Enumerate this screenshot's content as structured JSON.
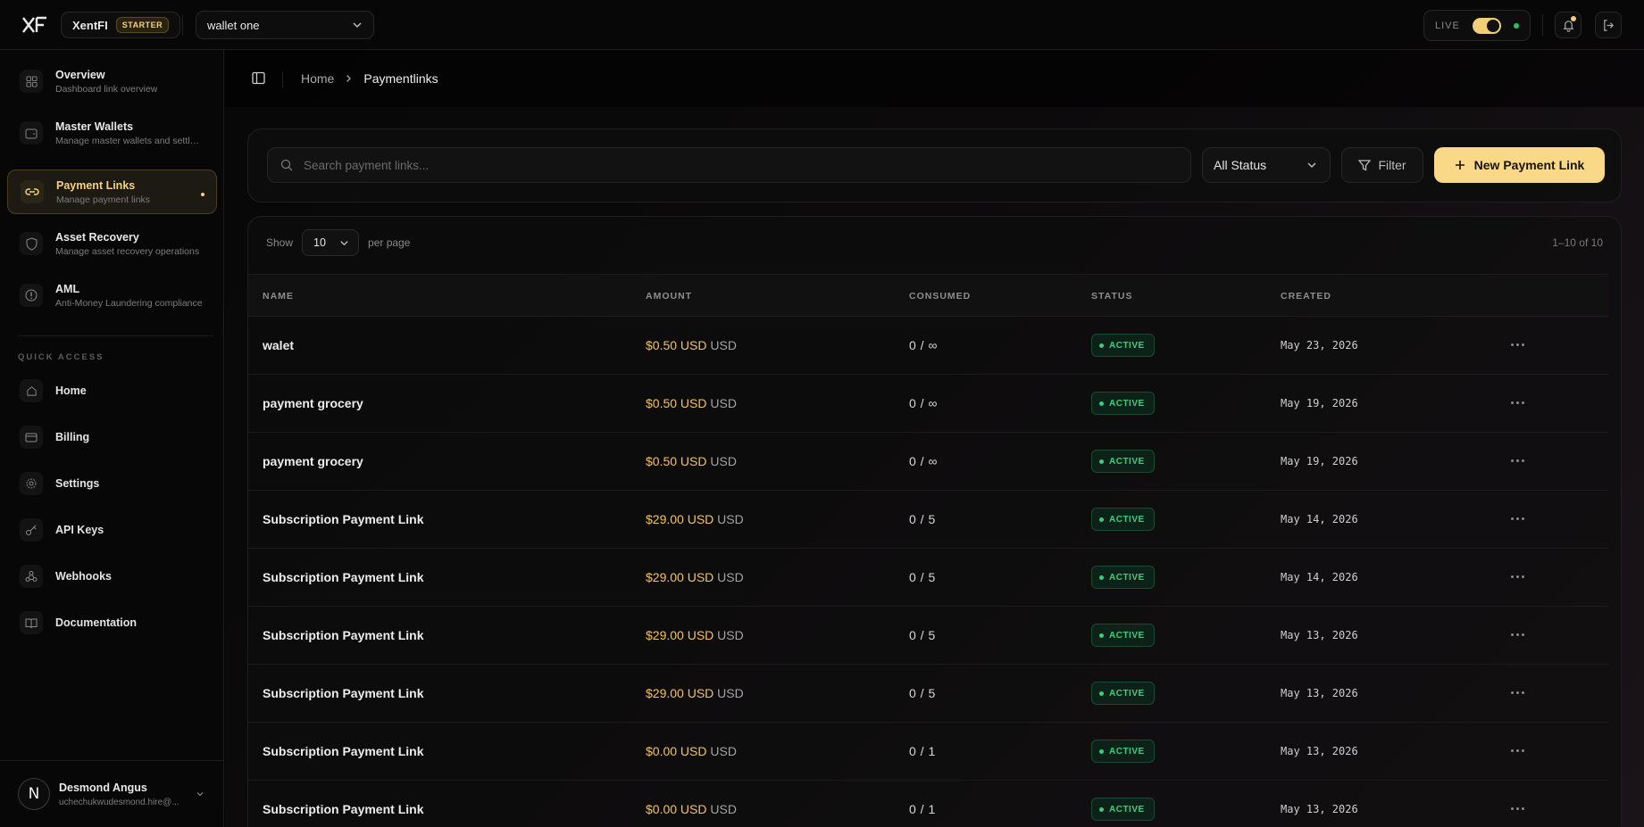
{
  "topbar": {
    "org_name": "XentFI",
    "plan_badge": "STARTER",
    "wallet": "wallet one",
    "live_label": "LIVE"
  },
  "sidebar": {
    "nav": [
      {
        "title": "Overview",
        "subtitle": "Dashboard link overview",
        "icon": "grid-icon",
        "active": false
      },
      {
        "title": "Master Wallets",
        "subtitle": "Manage master wallets and settle...",
        "icon": "wallet-icon",
        "active": false
      },
      {
        "title": "Payment Links",
        "subtitle": "Manage payment links",
        "icon": "link-icon",
        "active": true
      },
      {
        "title": "Asset Recovery",
        "subtitle": "Manage asset recovery operations",
        "icon": "shield-icon",
        "active": false
      },
      {
        "title": "AML",
        "subtitle": "Anti-Money Laundering compliance",
        "icon": "alert-icon",
        "active": false
      }
    ],
    "quick_access_label": "QUICK ACCESS",
    "quick": [
      {
        "label": "Home",
        "icon": "home-icon"
      },
      {
        "label": "Billing",
        "icon": "card-icon"
      },
      {
        "label": "Settings",
        "icon": "gear-icon"
      },
      {
        "label": "API Keys",
        "icon": "key-icon"
      },
      {
        "label": "Webhooks",
        "icon": "webhook-icon"
      },
      {
        "label": "Documentation",
        "icon": "book-icon"
      }
    ],
    "user": {
      "initial": "N",
      "name": "Desmond Angus",
      "email": "uchechukwudesmond.hire@..."
    }
  },
  "breadcrumb": {
    "home": "Home",
    "current": "Paymentlinks"
  },
  "toolbar": {
    "search_placeholder": "Search payment links...",
    "status_filter": "All Status",
    "filter_label": "Filter",
    "new_button": "New Payment Link"
  },
  "table": {
    "show_label": "Show",
    "per_page_value": "10",
    "per_page_label": "per page",
    "count_label": "1–10 of 10",
    "columns": {
      "name": "NAME",
      "amount": "AMOUNT",
      "consumed": "CONSUMED",
      "status": "STATUS",
      "created": "CREATED"
    },
    "rows": [
      {
        "name": "walet",
        "amount": "$0.50 USD",
        "currency": "USD",
        "consumed": "0 / ∞",
        "status": "ACTIVE",
        "created": "May 23, 2026"
      },
      {
        "name": "payment grocery",
        "amount": "$0.50 USD",
        "currency": "USD",
        "consumed": "0 / ∞",
        "status": "ACTIVE",
        "created": "May 19, 2026"
      },
      {
        "name": "payment grocery",
        "amount": "$0.50 USD",
        "currency": "USD",
        "consumed": "0 / ∞",
        "status": "ACTIVE",
        "created": "May 19, 2026"
      },
      {
        "name": "Subscription Payment Link",
        "amount": "$29.00 USD",
        "currency": "USD",
        "consumed": "0 / 5",
        "status": "ACTIVE",
        "created": "May 14, 2026"
      },
      {
        "name": "Subscription Payment Link",
        "amount": "$29.00 USD",
        "currency": "USD",
        "consumed": "0 / 5",
        "status": "ACTIVE",
        "created": "May 14, 2026"
      },
      {
        "name": "Subscription Payment Link",
        "amount": "$29.00 USD",
        "currency": "USD",
        "consumed": "0 / 5",
        "status": "ACTIVE",
        "created": "May 13, 2026"
      },
      {
        "name": "Subscription Payment Link",
        "amount": "$29.00 USD",
        "currency": "USD",
        "consumed": "0 / 5",
        "status": "ACTIVE",
        "created": "May 13, 2026"
      },
      {
        "name": "Subscription Payment Link",
        "amount": "$0.00 USD",
        "currency": "USD",
        "consumed": "0 / 1",
        "status": "ACTIVE",
        "created": "May 13, 2026"
      },
      {
        "name": "Subscription Payment Link",
        "amount": "$0.00 USD",
        "currency": "USD",
        "consumed": "0 / 1",
        "status": "ACTIVE",
        "created": "May 13, 2026"
      }
    ]
  },
  "colors": {
    "accent": "#f9d887",
    "amount": "#f5c25c",
    "active_status": "#36d07c"
  }
}
